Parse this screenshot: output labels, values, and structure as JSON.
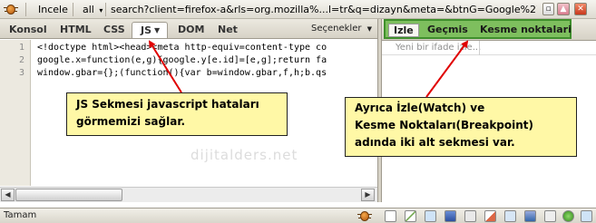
{
  "topbar": {
    "inspect_label": "Incele",
    "filter_label": "all",
    "filter_caret": "▾",
    "url": "search?client=firefox-a&rls=org.mozilla%...l=tr&q=dizayn&meta=&btnG=Google%27da+Ara"
  },
  "tabs": {
    "items": [
      {
        "label": "Konsol"
      },
      {
        "label": "HTML"
      },
      {
        "label": "CSS"
      },
      {
        "label": "JS"
      },
      {
        "label": "DOM"
      },
      {
        "label": "Net"
      }
    ],
    "options_label": "Seçenekler"
  },
  "code": {
    "line_numbers": [
      "1",
      "2",
      "3"
    ],
    "lines": [
      "<!doctype html><head><meta http-equiv=content-type co",
      "google.x=function(e,g){google.y[e.id]=[e,g];return fa",
      "window.gbar={};(function(){var b=window.gbar,f,h;b.qs"
    ]
  },
  "right_panel": {
    "tabs": [
      {
        "label": "Izle"
      },
      {
        "label": "Geçmis"
      },
      {
        "label": "Kesme noktalari"
      }
    ],
    "watch_placeholder": "Yeni bir ifade izle..."
  },
  "callouts": {
    "left": {
      "line1": "JS Sekmesi javascript hataları",
      "line2": "görmemizi sağlar."
    },
    "right": {
      "line1": "Ayrıca İzle(Watch) ve",
      "line2": "Kesme Noktaları(Breakpoint)",
      "line3": "adında iki alt sekmesi var."
    }
  },
  "watermark": "dijitalders.net",
  "statusbar": {
    "text": "Tamam"
  },
  "colors": {
    "callout_bg": "#fff8a6",
    "highlight_green": "#7ebf5e",
    "arrow_red": "#e00000"
  }
}
